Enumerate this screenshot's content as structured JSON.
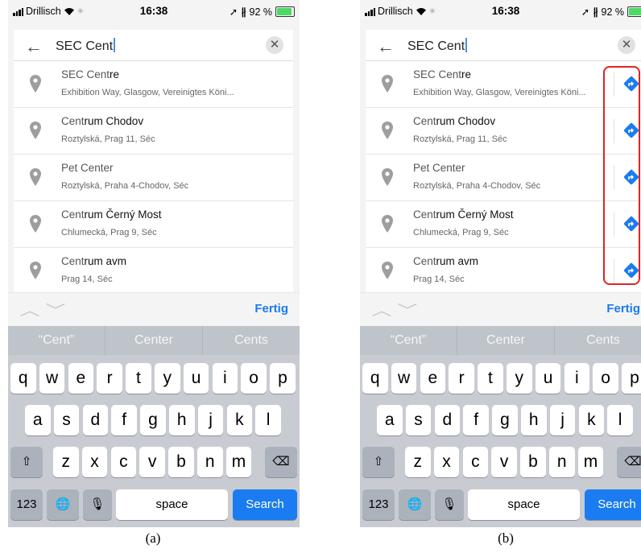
{
  "status": {
    "carrier": "Drillisch",
    "time": "16:38",
    "battery": "92 %"
  },
  "search": {
    "query": "SEC Cent"
  },
  "results": [
    {
      "match": "SEC Cent",
      "rest": "re",
      "address": "Exhibition Way, Glasgow, Vereinigtes Köni..."
    },
    {
      "match": "Cent",
      "rest": "rum Chodov",
      "address": "Roztylská, Prag 11, Séc"
    },
    {
      "match": "Pet Center",
      "rest": "",
      "address": "Roztylská, Praha 4-Chodov, Séc"
    },
    {
      "match": "Cent",
      "rest": "rum Černý Most",
      "address": "Chlumecká, Prag 9, Séc"
    },
    {
      "match": "Cent",
      "rest": "rum avm",
      "address": "Prag 14, Séc"
    }
  ],
  "accessory": {
    "done_label": "Fertig"
  },
  "predictions": [
    "“Cent”",
    "Center",
    "Cents"
  ],
  "keys": {
    "row1": [
      "q",
      "w",
      "e",
      "r",
      "t",
      "y",
      "u",
      "i",
      "o",
      "p"
    ],
    "row2": [
      "a",
      "s",
      "d",
      "f",
      "g",
      "h",
      "j",
      "k",
      "l"
    ],
    "row3": [
      "z",
      "x",
      "c",
      "v",
      "b",
      "n",
      "m"
    ],
    "numbers": "123",
    "space": "space",
    "search": "Search"
  },
  "captions": {
    "a": "(a)",
    "b": "(b)"
  },
  "colors": {
    "accent": "#1a7cf0",
    "highlight": "#e02424",
    "battery": "#4cd964"
  },
  "icons": [
    "back-arrow-icon",
    "clear-icon",
    "location-pin-icon",
    "directions-icon",
    "chevron-up-icon",
    "chevron-down-icon",
    "shift-icon",
    "backspace-icon",
    "globe-icon",
    "microphone-icon"
  ]
}
